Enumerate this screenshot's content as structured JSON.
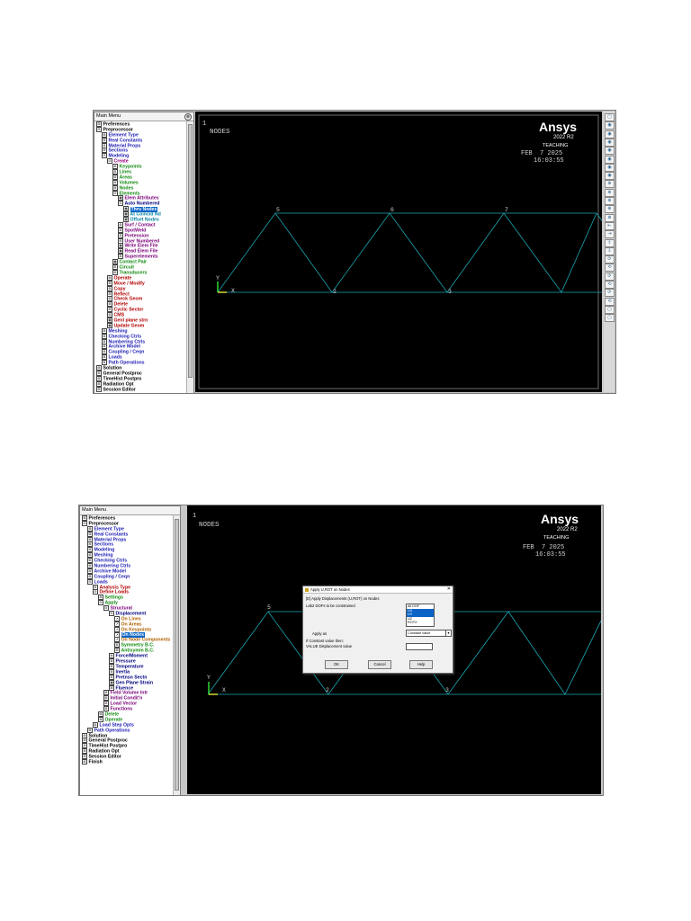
{
  "colors": {
    "preferences": "#000000",
    "preprocessor": "#000000",
    "element_type": "#1c1cb4",
    "real_constants": "#1c1cb4",
    "material_props": "#1c1cb4",
    "sections": "#1c1cb4",
    "modeling": "#1c1cb4",
    "create": "#9a007a",
    "keypoints": "#118a11",
    "lines": "#118a11",
    "areas": "#118a11",
    "volumes": "#118a11",
    "nodes": "#118a11",
    "elements": "#118a11",
    "elem_attributes": "#7a007a",
    "auto_numbered": "#000080",
    "thru_nodes": "#000080",
    "at_coincid": "#0080a0",
    "offset_nodes": "#0080a0",
    "surf_contact": "#7a007a",
    "spotweld": "#7a007a",
    "pretension": "#7a007a",
    "user_numbered": "#7a007a",
    "write_elem": "#7a007a",
    "read_elem": "#7a007a",
    "superelements": "#7a007a",
    "contact_pair": "#118a11",
    "circuit": "#118a11",
    "transducers": "#118a11",
    "operate": "#b00000",
    "move": "#b00000",
    "copy": "#b00000",
    "reflect": "#b00000",
    "check_geom": "#b00000",
    "delete": "#b00000",
    "cyclic": "#b00000",
    "cms": "#b00000",
    "genl_plane": "#b00000",
    "update": "#b00000",
    "meshing": "#1c1cb4",
    "solution": "#000000",
    "loads": "#1c1cb4",
    "analysis_type": "#b00000",
    "define_loads": "#b00000",
    "settings": "#118a11",
    "apply": "#118a11",
    "structural": "#7a007a",
    "displacement": "#000080",
    "on_lines": "#b06000",
    "on_node_comp": "#b06000",
    "sym": "#118a11",
    "antisym": "#118a11",
    "force": "#000080",
    "pressure": "#000080",
    "temperature": "#000080",
    "inertia": "#000080",
    "pretnsn": "#000080",
    "gen_plane": "#000080",
    "fluence": "#000080",
    "field_vol": "#7a007a",
    "initial": "#7a007a",
    "load_vector": "#7a007a",
    "functions": "#7a007a",
    "load_delete": "#118a11",
    "load_operate": "#118a11",
    "load_step": "#1c1cb4",
    "path_ops": "#1c1cb4",
    "graphics_bg": "#000000",
    "truss": "#1aa8b4",
    "node_label": "#d0d0d0",
    "axis_triad_y": "#2ed82e",
    "axis_triad_x": "#d8d82e"
  },
  "panel1": {
    "menu_title": "Main Menu",
    "menu_collapse_icon": "⊗",
    "tree": [
      {
        "indent": 0,
        "box": "⊞",
        "label": "Preferences",
        "color": "preferences"
      },
      {
        "indent": 0,
        "box": "⊟",
        "label": "Preprocessor",
        "color": "preprocessor"
      },
      {
        "indent": 1,
        "box": "⊞",
        "label": "Element Type",
        "color": "element_type"
      },
      {
        "indent": 1,
        "box": "⊞",
        "label": "Real Constants",
        "color": "real_constants"
      },
      {
        "indent": 1,
        "box": "⊞",
        "label": "Material Props",
        "color": "material_props"
      },
      {
        "indent": 1,
        "box": "⊞",
        "label": "Sections",
        "color": "sections"
      },
      {
        "indent": 1,
        "box": "⊟",
        "label": "Modeling",
        "color": "modeling"
      },
      {
        "indent": 2,
        "box": "⊟",
        "label": "Create",
        "color": "create"
      },
      {
        "indent": 3,
        "box": "⊞",
        "label": "Keypoints",
        "color": "keypoints"
      },
      {
        "indent": 3,
        "box": "⊞",
        "label": "Lines",
        "color": "lines"
      },
      {
        "indent": 3,
        "box": "⊞",
        "label": "Areas",
        "color": "areas"
      },
      {
        "indent": 3,
        "box": "⊞",
        "label": "Volumes",
        "color": "volumes"
      },
      {
        "indent": 3,
        "box": "⊞",
        "label": "Nodes",
        "color": "nodes"
      },
      {
        "indent": 3,
        "box": "⊟",
        "label": "Elements",
        "color": "elements"
      },
      {
        "indent": 4,
        "box": "▦",
        "label": "Elem Attributes",
        "color": "elem_attributes"
      },
      {
        "indent": 4,
        "box": "⊟",
        "label": "Auto Numbered",
        "color": "auto_numbered"
      },
      {
        "indent": 5,
        "box": "▦",
        "label": "Thru Nodes",
        "color": "thru_nodes",
        "sel": true
      },
      {
        "indent": 5,
        "box": "▦",
        "label": "At Coincid Nd",
        "color": "at_coincid"
      },
      {
        "indent": 5,
        "box": "▦",
        "label": "Offset Nodes",
        "color": "offset_nodes"
      },
      {
        "indent": 4,
        "box": "⊞",
        "label": "Surf / Contact",
        "color": "surf_contact"
      },
      {
        "indent": 4,
        "box": "⊞",
        "label": "SpotWeld",
        "color": "spotweld"
      },
      {
        "indent": 4,
        "box": "⊞",
        "label": "Pretension",
        "color": "pretension"
      },
      {
        "indent": 4,
        "box": "⊞",
        "label": "User Numbered",
        "color": "user_numbered"
      },
      {
        "indent": 4,
        "box": "▦",
        "label": "Write Elem File",
        "color": "write_elem"
      },
      {
        "indent": 4,
        "box": "▦",
        "label": "Read Elem File",
        "color": "read_elem"
      },
      {
        "indent": 4,
        "box": "⊞",
        "label": "Superelements",
        "color": "superelements"
      },
      {
        "indent": 3,
        "box": "▦",
        "label": "Contact Pair",
        "color": "contact_pair"
      },
      {
        "indent": 3,
        "box": "⊞",
        "label": "Circuit",
        "color": "circuit"
      },
      {
        "indent": 3,
        "box": "⊞",
        "label": "Transducers",
        "color": "transducers"
      },
      {
        "indent": 2,
        "box": "⊞",
        "label": "Operate",
        "color": "operate"
      },
      {
        "indent": 2,
        "box": "⊞",
        "label": "Move / Modify",
        "color": "move"
      },
      {
        "indent": 2,
        "box": "⊞",
        "label": "Copy",
        "color": "copy"
      },
      {
        "indent": 2,
        "box": "⊞",
        "label": "Reflect",
        "color": "reflect"
      },
      {
        "indent": 2,
        "box": "⊞",
        "label": "Check Geom",
        "color": "check_geom"
      },
      {
        "indent": 2,
        "box": "⊞",
        "label": "Delete",
        "color": "delete"
      },
      {
        "indent": 2,
        "box": "⊞",
        "label": "Cyclic Sector",
        "color": "cyclic"
      },
      {
        "indent": 2,
        "box": "⊞",
        "label": "CMS",
        "color": "cms"
      },
      {
        "indent": 2,
        "box": "▦",
        "label": "Genl plane strn",
        "color": "genl_plane"
      },
      {
        "indent": 2,
        "box": "▦",
        "label": "Update Geom",
        "color": "update"
      },
      {
        "indent": 1,
        "box": "⊞",
        "label": "Meshing",
        "color": "meshing"
      },
      {
        "indent": 1,
        "box": "⊞",
        "label": "Checking Ctrls",
        "color": "meshing"
      },
      {
        "indent": 1,
        "box": "⊞",
        "label": "Numbering Ctrls",
        "color": "meshing"
      },
      {
        "indent": 1,
        "box": "⊞",
        "label": "Archive Model",
        "color": "meshing"
      },
      {
        "indent": 1,
        "box": "⊞",
        "label": "Coupling / Ceqn",
        "color": "meshing"
      },
      {
        "indent": 1,
        "box": "⊞",
        "label": "Loads",
        "color": "meshing"
      },
      {
        "indent": 1,
        "box": "⊞",
        "label": "Path Operations",
        "color": "meshing"
      },
      {
        "indent": 0,
        "box": "⊞",
        "label": "Solution",
        "color": "solution"
      },
      {
        "indent": 0,
        "box": "⊞",
        "label": "General Postproc",
        "color": "solution"
      },
      {
        "indent": 0,
        "box": "⊞",
        "label": "TimeHist Postpro",
        "color": "solution"
      },
      {
        "indent": 0,
        "box": "⊞",
        "label": "Radiation Opt",
        "color": "solution"
      },
      {
        "indent": 0,
        "box": "⊞",
        "label": "Session Editor",
        "color": "solution"
      }
    ],
    "window_num": "1",
    "view_label": "NODES",
    "brand": "Ansys",
    "version": "2022 R2",
    "license": "TEACHING",
    "date": "FEB  7 2025",
    "time": "16:03:55",
    "nodes_top": [
      "5",
      "6",
      "7"
    ],
    "nodes_bottom": [
      "2",
      "3",
      "4"
    ],
    "axis_y": "Y",
    "axis_x": "X"
  },
  "panel2": {
    "menu_title": "Main Menu",
    "menu_collapse_icon": "⊗",
    "tree": [
      {
        "indent": 0,
        "box": "⊞",
        "label": "Preferences",
        "color": "preferences"
      },
      {
        "indent": 0,
        "box": "⊟",
        "label": "Preprocessor",
        "color": "preprocessor"
      },
      {
        "indent": 1,
        "box": "⊞",
        "label": "Element Type",
        "color": "element_type"
      },
      {
        "indent": 1,
        "box": "⊞",
        "label": "Real Constants",
        "color": "real_constants"
      },
      {
        "indent": 1,
        "box": "⊞",
        "label": "Material Props",
        "color": "material_props"
      },
      {
        "indent": 1,
        "box": "⊞",
        "label": "Sections",
        "color": "sections"
      },
      {
        "indent": 1,
        "box": "⊞",
        "label": "Modeling",
        "color": "modeling"
      },
      {
        "indent": 1,
        "box": "⊞",
        "label": "Meshing",
        "color": "meshing"
      },
      {
        "indent": 1,
        "box": "⊞",
        "label": "Checking Ctrls",
        "color": "meshing"
      },
      {
        "indent": 1,
        "box": "⊞",
        "label": "Numbering Ctrls",
        "color": "meshing"
      },
      {
        "indent": 1,
        "box": "⊞",
        "label": "Archive Model",
        "color": "meshing"
      },
      {
        "indent": 1,
        "box": "⊞",
        "label": "Coupling / Ceqn",
        "color": "meshing"
      },
      {
        "indent": 1,
        "box": "⊟",
        "label": "Loads",
        "color": "loads"
      },
      {
        "indent": 2,
        "box": "⊞",
        "label": "Analysis Type",
        "color": "analysis_type"
      },
      {
        "indent": 2,
        "box": "⊟",
        "label": "Define Loads",
        "color": "define_loads"
      },
      {
        "indent": 3,
        "box": "⊞",
        "label": "Settings",
        "color": "settings"
      },
      {
        "indent": 3,
        "box": "⊟",
        "label": "Apply",
        "color": "apply"
      },
      {
        "indent": 4,
        "box": "⊟",
        "label": "Structural",
        "color": "structural"
      },
      {
        "indent": 5,
        "box": "⊟",
        "label": "Displacement",
        "color": "displacement"
      },
      {
        "indent": 6,
        "box": "↗",
        "label": "On Lines",
        "color": "on_lines"
      },
      {
        "indent": 6,
        "box": "↗",
        "label": "On Areas",
        "color": "on_lines"
      },
      {
        "indent": 6,
        "box": "↗",
        "label": "On Keypoints",
        "color": "on_lines"
      },
      {
        "indent": 6,
        "box": "↗",
        "label": "On Nodes",
        "color": "on_lines",
        "sel": true
      },
      {
        "indent": 6,
        "box": "↗",
        "label": "On Node Components",
        "color": "on_node_comp"
      },
      {
        "indent": 6,
        "box": "⊞",
        "label": "Symmetry B.C.",
        "color": "sym"
      },
      {
        "indent": 6,
        "box": "⊞",
        "label": "Antisymm B.C.",
        "color": "antisym"
      },
      {
        "indent": 5,
        "box": "⊞",
        "label": "Force/Moment",
        "color": "force"
      },
      {
        "indent": 5,
        "box": "⊞",
        "label": "Pressure",
        "color": "pressure"
      },
      {
        "indent": 5,
        "box": "⊞",
        "label": "Temperature",
        "color": "temperature"
      },
      {
        "indent": 5,
        "box": "⊞",
        "label": "Inertia",
        "color": "inertia"
      },
      {
        "indent": 5,
        "box": "⊞",
        "label": "Pretnsn Sectn",
        "color": "pretnsn"
      },
      {
        "indent": 5,
        "box": "▦",
        "label": "Gen Plane Strain",
        "color": "gen_plane"
      },
      {
        "indent": 5,
        "box": "⊞",
        "label": "Fluence",
        "color": "fluence"
      },
      {
        "indent": 4,
        "box": "⊞",
        "label": "Field Volume Intr",
        "color": "field_vol"
      },
      {
        "indent": 4,
        "box": "⊞",
        "label": "Initial Condit'n",
        "color": "initial"
      },
      {
        "indent": 4,
        "box": "⊞",
        "label": "Load Vector",
        "color": "load_vector"
      },
      {
        "indent": 4,
        "box": "⊞",
        "label": "Functions",
        "color": "functions"
      },
      {
        "indent": 3,
        "box": "⊞",
        "label": "Delete",
        "color": "load_delete"
      },
      {
        "indent": 3,
        "box": "⊞",
        "label": "Operate",
        "color": "load_operate"
      },
      {
        "indent": 2,
        "box": "⊞",
        "label": "Load Step Opts",
        "color": "load_step"
      },
      {
        "indent": 1,
        "box": "⊞",
        "label": "Path Operations",
        "color": "path_ops"
      },
      {
        "indent": 0,
        "box": "⊞",
        "label": "Solution",
        "color": "solution"
      },
      {
        "indent": 0,
        "box": "⊞",
        "label": "General Postproc",
        "color": "solution"
      },
      {
        "indent": 0,
        "box": "⊞",
        "label": "TimeHist Postpro",
        "color": "solution"
      },
      {
        "indent": 0,
        "box": "⊞",
        "label": "Radiation Opt",
        "color": "solution"
      },
      {
        "indent": 0,
        "box": "⊞",
        "label": "Session Editor",
        "color": "solution"
      },
      {
        "indent": 0,
        "box": "⊞",
        "label": "Finish",
        "color": "solution"
      }
    ],
    "window_num": "1",
    "view_label": "NODES",
    "brand": "Ansys",
    "version": "2022 R2",
    "license": "TEACHING",
    "date": "FEB  7 2025",
    "time": "16:03:55",
    "nodes_top": [
      "5",
      "6",
      "7"
    ],
    "nodes_bottom": [
      "2",
      "3",
      "4"
    ],
    "axis_y": "Y",
    "axis_x": "X",
    "dialog": {
      "title": "Apply U,ROT on Nodes",
      "close_icon": "✕",
      "heading": "[D]  Apply Displacements (U,ROT) on Nodes",
      "lab2_label": "Lab2   DOFs to be constrained",
      "dof_options": [
        "All DOF",
        "UX",
        "UY",
        "UZ",
        "ROTX"
      ],
      "apply_as_label": "Apply as",
      "apply_as_value": "Constant value",
      "const_hint": "If Constant value then:",
      "value_label": "VALUE  Displacement value",
      "ok": "OK",
      "cancel": "Cancel",
      "help": "Help"
    }
  }
}
